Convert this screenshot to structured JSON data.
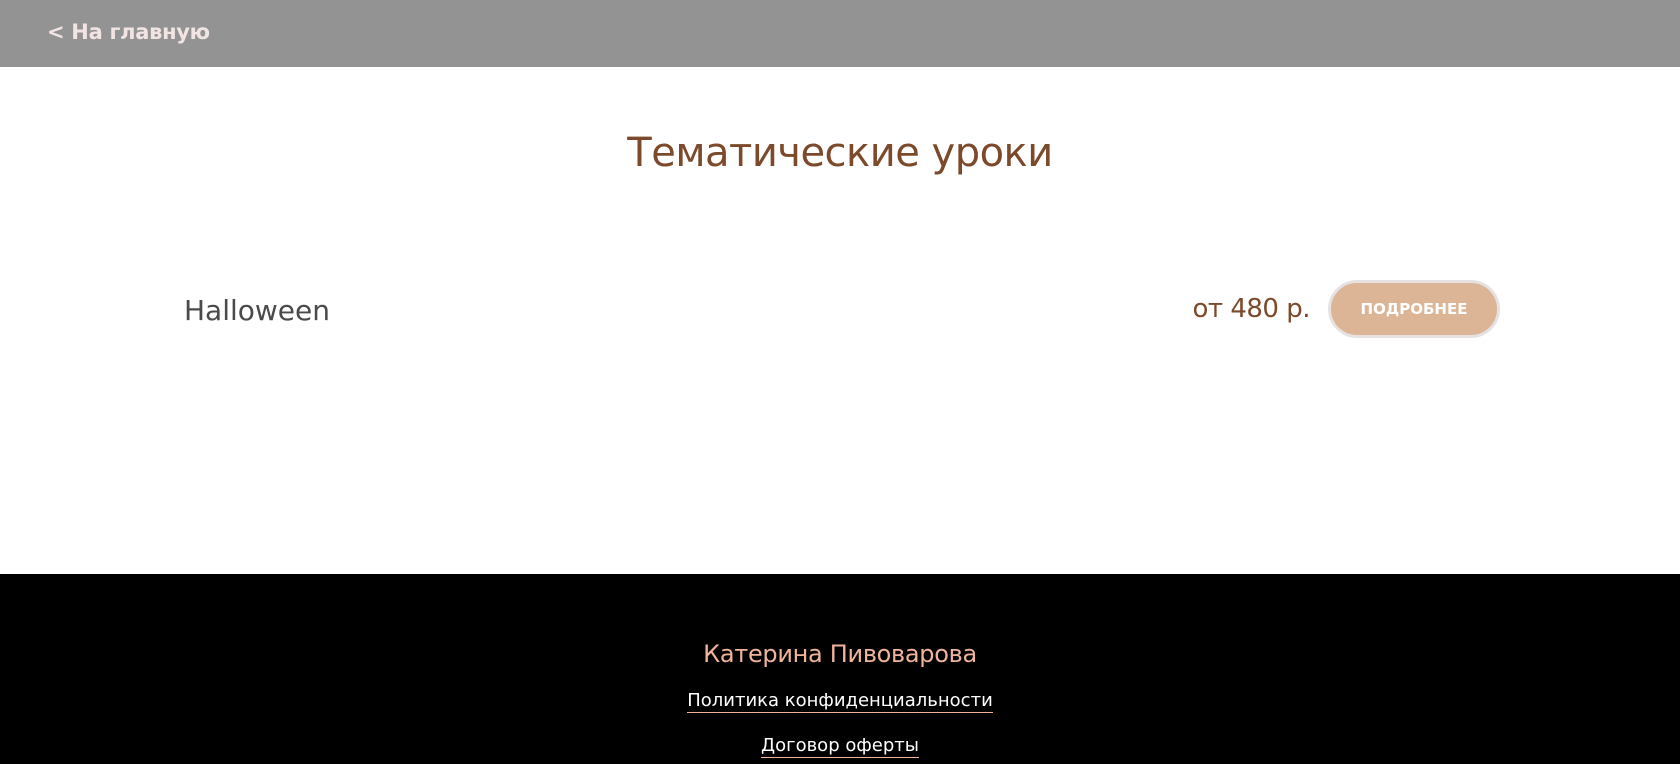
{
  "header": {
    "back_label": "< На главную"
  },
  "main": {
    "title": "Тематические уроки",
    "lessons": [
      {
        "name": "Halloween",
        "price": "от 480 р.",
        "button_label": "ПОДРОБНЕЕ"
      }
    ]
  },
  "footer": {
    "name": "Катерина Пивоварова",
    "links": [
      {
        "label": "Политика конфиденциальности"
      },
      {
        "label": "Договор оферты"
      }
    ]
  },
  "colors": {
    "topbar": "#939393",
    "accent_brown": "#7c4a2b",
    "button_bg": "#dcb496",
    "footer_bg": "#000000",
    "footer_name": "#efb49a"
  }
}
